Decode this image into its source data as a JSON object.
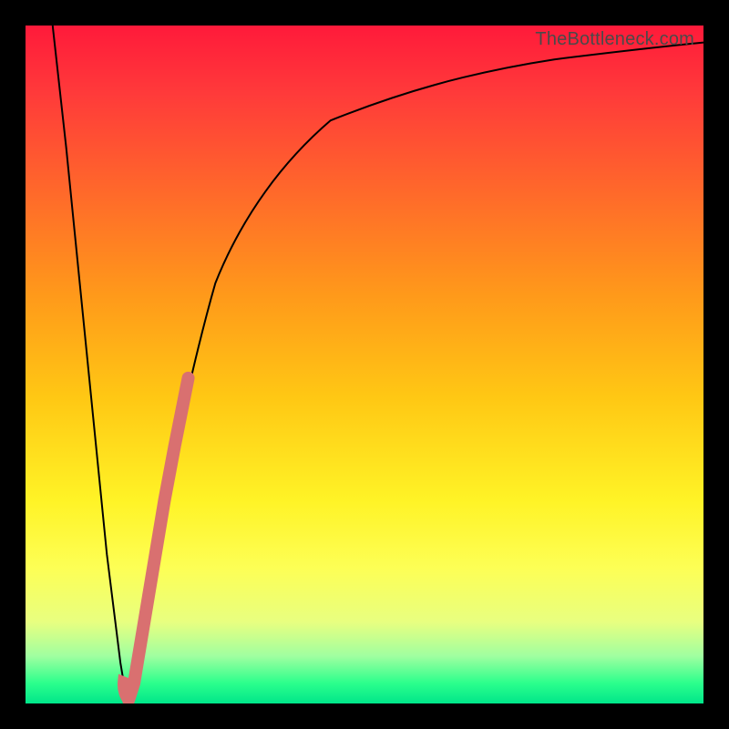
{
  "watermark": "TheBottleneck.com",
  "chart_data": {
    "type": "line",
    "title": "",
    "xlabel": "",
    "ylabel": "",
    "xlim": [
      0,
      100
    ],
    "ylim": [
      0,
      100
    ],
    "grid": false,
    "series": [
      {
        "name": "bottleneck-curve",
        "x": [
          4,
          6,
          8,
          10,
          12,
          14,
          15,
          16,
          18,
          20,
          24,
          28,
          32,
          38,
          45,
          55,
          65,
          78,
          90,
          100
        ],
        "y": [
          100,
          82,
          62,
          42,
          22,
          6,
          0,
          4,
          16,
          28,
          48,
          62,
          72,
          80,
          86,
          90,
          93,
          95,
          96.5,
          97.5
        ]
      },
      {
        "name": "highlight-segment",
        "x": [
          15.2,
          16.0,
          17.5,
          19.0,
          20.5,
          22.0,
          24.0
        ],
        "y": [
          0.5,
          3,
          12,
          21,
          30,
          38,
          48
        ]
      },
      {
        "name": "highlight-hook",
        "x": [
          15.2,
          14.6,
          14.3,
          14.4,
          14.9
        ],
        "y": [
          0.5,
          1.0,
          2.2,
          3.2,
          3.0
        ]
      }
    ],
    "colors": {
      "curve": "#000000",
      "highlight": "#d97070"
    }
  }
}
